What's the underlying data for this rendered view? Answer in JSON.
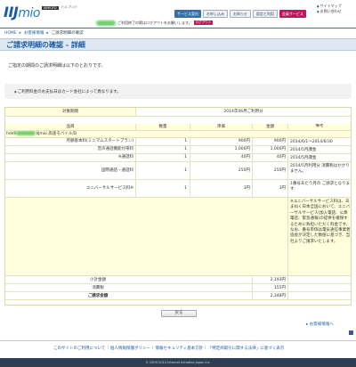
{
  "header": {
    "logo_main": "IIJ",
    "logo_sub": "mio",
    "logo_tag": "IIJMIOFD",
    "logo_tagline": "ドル アンド",
    "nav_tabs": [
      {
        "label": "サービス案内",
        "active": false
      },
      {
        "label": "お申し込み",
        "active": false
      },
      {
        "label": "お知らせ",
        "active": false
      },
      {
        "label": "設定と利用",
        "active": false
      },
      {
        "label": "会員サービス",
        "active": true
      }
    ],
    "top_links": [
      "サイトマップ",
      "お問い合わせ"
    ],
    "user_message": "ご利用終了の際はログアウトをお願いします。",
    "logout_label": "ログアウト"
  },
  "breadcrumb": [
    "HOME",
    "お客様情報",
    "ご請求明細の確認"
  ],
  "page_title": "ご請求明細の確認 - 詳細",
  "intro_text": "ご指定の期間のご請求明細は以下のとおりです。",
  "notice_text": "ご利用料金のお支払日はカード会社によって異なります。",
  "bill": {
    "period_label": "対象期間",
    "period_value": "2014年06月ご利用分",
    "columns": [
      "品目",
      "数量",
      "単価",
      "金額",
      "備考"
    ],
    "account_id": "hdd0",
    "plan_name": "IIJmio 高速モバイル/D",
    "items": [
      {
        "name": "月額基本料(ミニマムスタートプラン)",
        "qty": "1",
        "unit": "900円",
        "amount": "900円",
        "note": "2014/6/1〜2014/6/30"
      },
      {
        "name": "音声通話機能付帯料",
        "qty": "1",
        "unit": "1,000円",
        "amount": "1,000円",
        "note": "2014/5月課金"
      },
      {
        "name": "※通話料",
        "qty": "1",
        "unit": "40円",
        "amount": "40円",
        "note": "2014/5月課金"
      },
      {
        "name": "国際通話・通話料",
        "qty": "1",
        "unit": "250円",
        "amount": "250円",
        "note": "2014/5月利用分 消費税はかかりません。"
      },
      {
        "name": "ユニバーサルサービス料※",
        "qty": "1",
        "unit": "3円",
        "amount": "3円",
        "note": "1番号あたり月の ご請求となります"
      }
    ],
    "footnote": "※ユニバーサルサービス料は、あまねく日本全国において、ユニバーサルサービス(加入電話、公衆電話、緊急通報)の提供を確保するために負担いただく料金です。 なお、番号単価は電気通信事業者協会が決定した数値に基づき、当社よりご請求いたします。",
    "subtotal_label": "小計金額",
    "subtotal_value": "2,193円",
    "tax_label": "消費税",
    "tax_value": "155円",
    "total_label": "ご請求金額",
    "total_value": "2,348円"
  },
  "back_button": "戻る",
  "back_to_top": "お客様情報へ",
  "footer_links": [
    "このサイトのご利用について",
    "個人情報保護ポリシー",
    "情報セキュリティ基本方針",
    "「特定商取引に関する法律」に基づく表示"
  ],
  "copyright": "© 2009-2014 Internet Initiative Japan Inc.",
  "colors": {
    "brand": "#1a5ca8",
    "active_tab": "#c2185b",
    "table_bg": "#ffffdd"
  }
}
